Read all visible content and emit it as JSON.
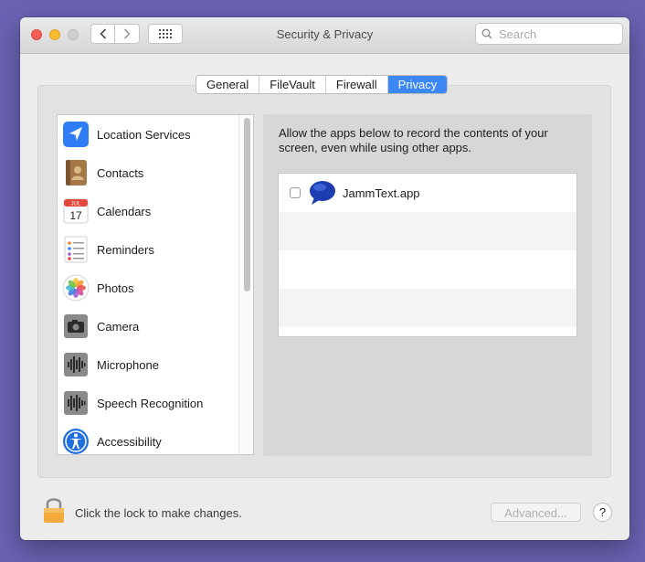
{
  "window": {
    "title": "Security & Privacy"
  },
  "search": {
    "placeholder": "Search"
  },
  "tabs": [
    {
      "label": "General",
      "active": false
    },
    {
      "label": "FileVault",
      "active": false
    },
    {
      "label": "Firewall",
      "active": false
    },
    {
      "label": "Privacy",
      "active": true
    }
  ],
  "sidebar": {
    "items": [
      {
        "label": "Location Services",
        "icon": "location-arrow-icon"
      },
      {
        "label": "Contacts",
        "icon": "contacts-book-icon"
      },
      {
        "label": "Calendars",
        "icon": "calendar-icon",
        "icon_month": "JUL",
        "icon_day": "17"
      },
      {
        "label": "Reminders",
        "icon": "reminders-list-icon"
      },
      {
        "label": "Photos",
        "icon": "photos-flower-icon"
      },
      {
        "label": "Camera",
        "icon": "camera-icon"
      },
      {
        "label": "Microphone",
        "icon": "microphone-waveform-icon"
      },
      {
        "label": "Speech Recognition",
        "icon": "speech-waveform-icon"
      },
      {
        "label": "Accessibility",
        "icon": "accessibility-icon"
      }
    ]
  },
  "main": {
    "description": "Allow the apps below to record the contents of your screen, even while using other apps.",
    "apps": [
      {
        "name": "JammText.app",
        "checked": false,
        "icon": "speech-bubble-icon"
      }
    ]
  },
  "footer": {
    "lock_text": "Click the lock to make changes.",
    "advanced_label": "Advanced...",
    "help_label": "?"
  },
  "colors": {
    "accent": "#3b87f5",
    "desktop": "#6a63b4"
  }
}
